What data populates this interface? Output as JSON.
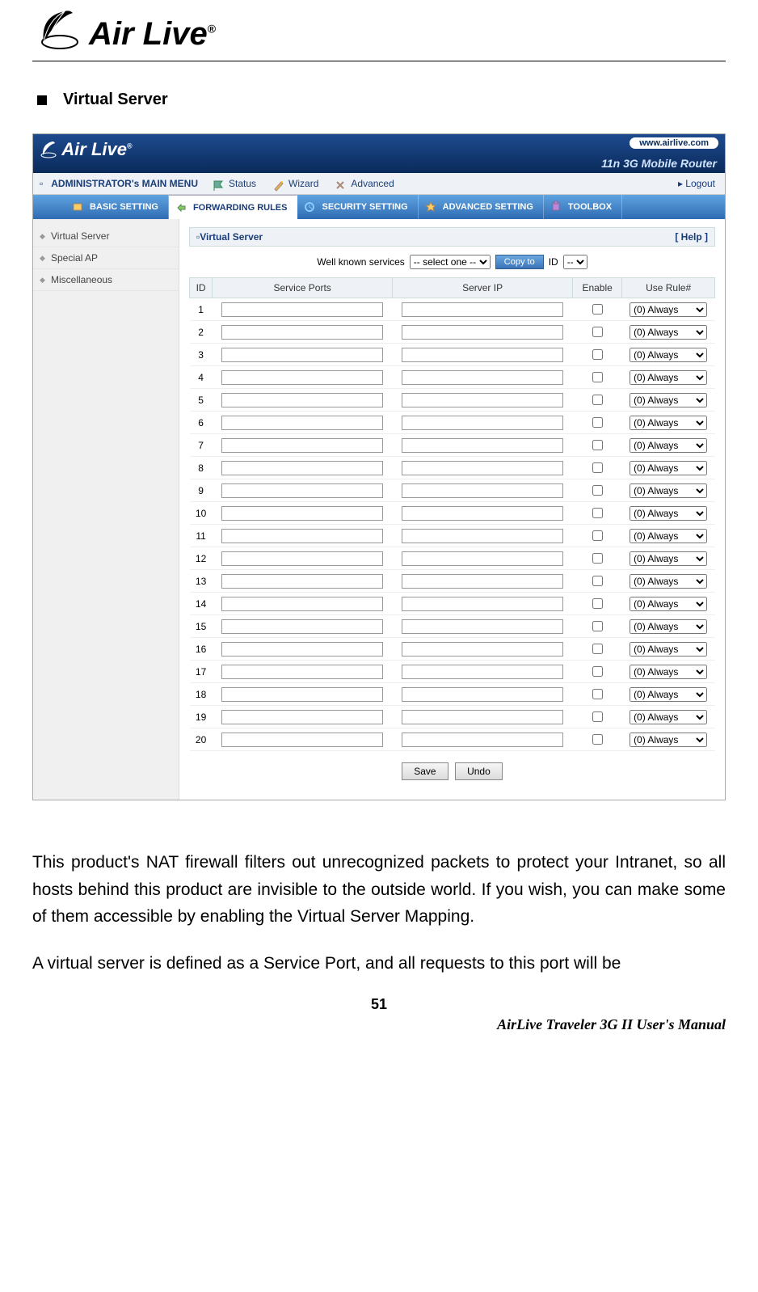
{
  "doc": {
    "logo_text": "Air Live",
    "logo_reg": "®",
    "section_title": "Virtual Server",
    "para1": "This product's NAT firewall filters out unrecognized packets to protect your Intranet, so all hosts behind this product are invisible to the outside world. If you wish, you can make some of them accessible by enabling the Virtual Server Mapping.",
    "para2": "A virtual server is defined as a Service Port, and all requests to this port will be",
    "page_num": "51",
    "footer": "AirLive  Traveler  3G  II  User's  Manual"
  },
  "ui": {
    "header": {
      "logo": "Air Live",
      "logo_reg": "®",
      "url_pill": "www.airlive.com",
      "subtitle": "11n 3G Mobile Router"
    },
    "topbar": {
      "menu_label": "ADMINISTRATOR's MAIN MENU",
      "items": [
        "Status",
        "Wizard",
        "Advanced"
      ],
      "logout": "▸ Logout"
    },
    "tabs": [
      {
        "label": "BASIC SETTING",
        "active": false
      },
      {
        "label": "FORWARDING RULES",
        "active": true
      },
      {
        "label": "SECURITY SETTING",
        "active": false
      },
      {
        "label": "ADVANCED SETTING",
        "active": false
      },
      {
        "label": "TOOLBOX",
        "active": false
      }
    ],
    "sidebar": [
      "Virtual Server",
      "Special AP",
      "Miscellaneous"
    ],
    "panel": {
      "title_icon_label": "Virtual Server",
      "help": "[ Help ]",
      "wk_label": "Well known services",
      "wk_selected": "-- select one --",
      "copy_btn": "Copy to",
      "id_label": "ID",
      "id_selected": "--",
      "columns": [
        "ID",
        "Service Ports",
        "Server IP",
        "Enable",
        "Use Rule#"
      ],
      "row_count": 20,
      "rule_option": "(0) Always",
      "save": "Save",
      "undo": "Undo"
    }
  }
}
